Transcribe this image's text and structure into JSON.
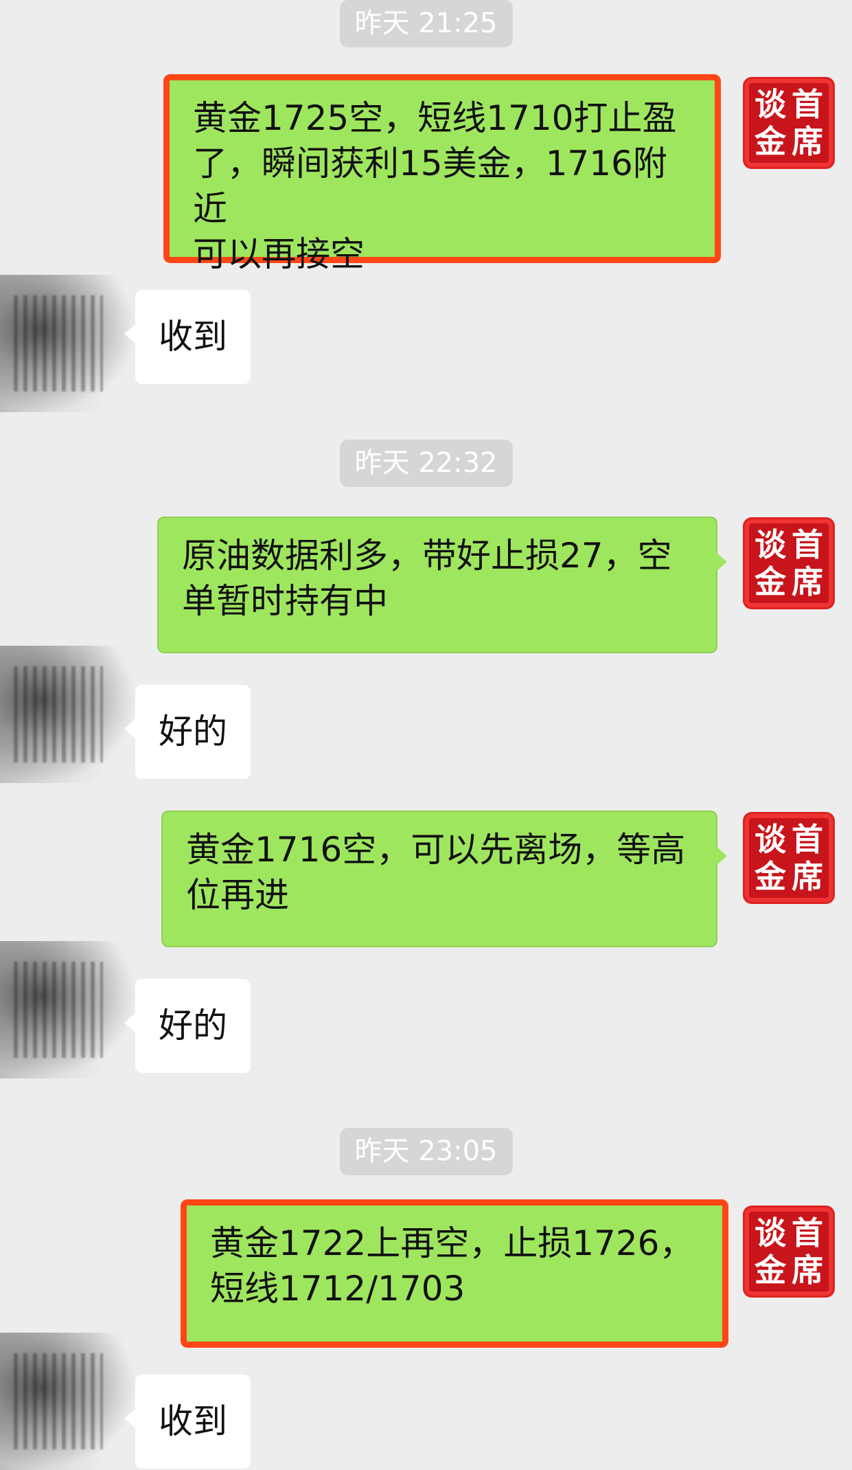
{
  "timestamps": [
    "昨天 21:25",
    "昨天 22:32",
    "昨天 23:05"
  ],
  "seal_text": [
    "谈",
    "首",
    "金",
    "席"
  ],
  "messages": [
    {
      "side": "out",
      "highlighted": true,
      "lines": [
        "黄金1725空，短线1710打止盈",
        "了，瞬间获利15美金，1716附近",
        "可以再接空"
      ]
    },
    {
      "side": "in",
      "text": "收到"
    },
    {
      "side": "out",
      "highlighted": false,
      "lines": [
        "原油数据利多，带好止损27，空",
        "单暂时持有中"
      ]
    },
    {
      "side": "in",
      "text": "好的"
    },
    {
      "side": "out",
      "highlighted": false,
      "lines": [
        "黄金1716空，可以先离场，等高",
        "位再进"
      ]
    },
    {
      "side": "in",
      "text": "好的"
    },
    {
      "side": "out",
      "highlighted": true,
      "lines": [
        "黄金1722上再空，止损1726，",
        "短线1712/1703"
      ]
    },
    {
      "side": "in",
      "text": "收到"
    }
  ],
  "colors": {
    "outgoing_bubble": "#9fe65f",
    "highlight_border": "#ff4616",
    "seal_red": "#c8141b",
    "background": "#ededed"
  }
}
